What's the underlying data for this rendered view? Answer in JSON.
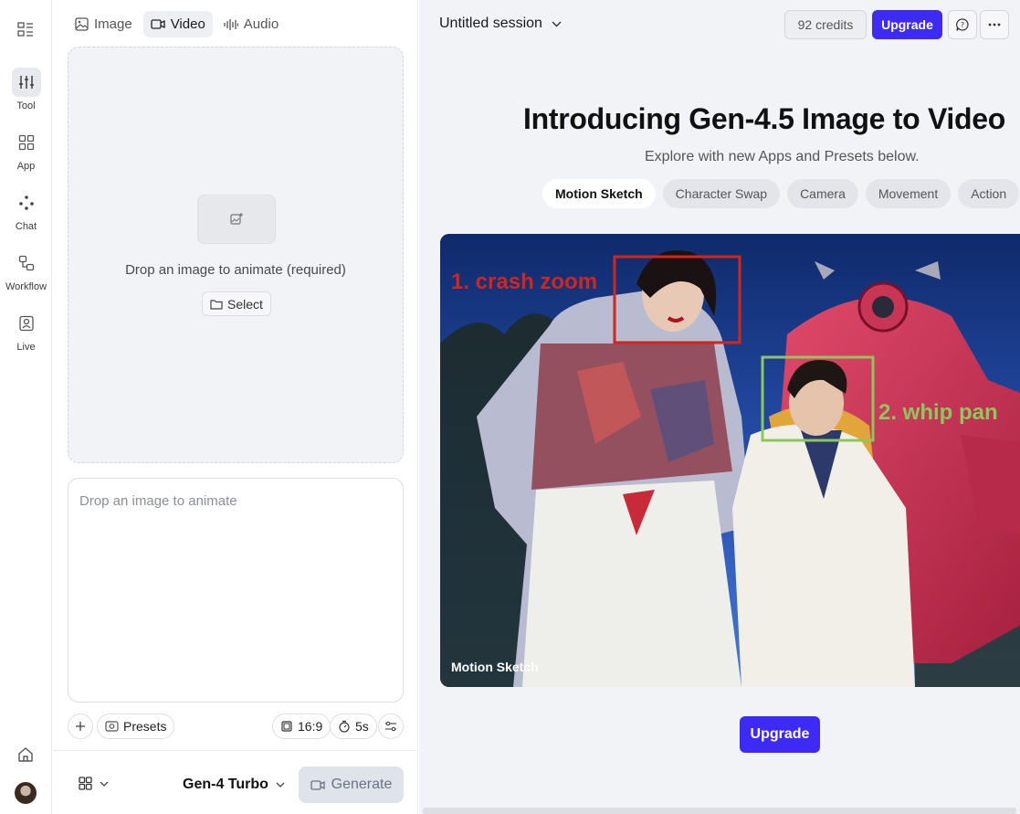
{
  "rail": {
    "items": [
      {
        "label": "Tool",
        "icon": "sliders-icon"
      },
      {
        "label": "App",
        "icon": "apps-grid-icon"
      },
      {
        "label": "Chat",
        "icon": "dots-icon"
      },
      {
        "label": "Workflow",
        "icon": "workflow-icon"
      },
      {
        "label": "Live",
        "icon": "live-portrait-icon"
      }
    ]
  },
  "panel": {
    "tabs": [
      {
        "label": "Image",
        "icon": "image-icon"
      },
      {
        "label": "Video",
        "icon": "video-icon"
      },
      {
        "label": "Audio",
        "icon": "audio-wave-icon"
      }
    ],
    "dropzone_text": "Drop an image to animate (required)",
    "select_label": "Select",
    "prompt_placeholder": "Drop an image to animate",
    "presets_label": "Presets",
    "ratio_label": "16:9",
    "duration_label": "5s",
    "model_label": "Gen-4 Turbo",
    "generate_label": "Generate"
  },
  "header": {
    "session_title": "Untitled session",
    "credits_label": "92 credits",
    "upgrade_label": "Upgrade"
  },
  "main": {
    "headline": "Introducing Gen-4.5 Image to Video",
    "subline": "Explore with new Apps and Presets below.",
    "chips": [
      "Motion Sketch",
      "Character Swap",
      "Camera",
      "Movement",
      "Action"
    ],
    "hero_annotation_1": "1. crash zoom",
    "hero_annotation_2": "2. whip pan",
    "hero_caption": "Motion Sketch",
    "upgrade_label": "Upgrade"
  },
  "colors": {
    "accent": "#3d2bf5",
    "annotation_red": "#d0261c",
    "annotation_green": "#8cc85a"
  }
}
